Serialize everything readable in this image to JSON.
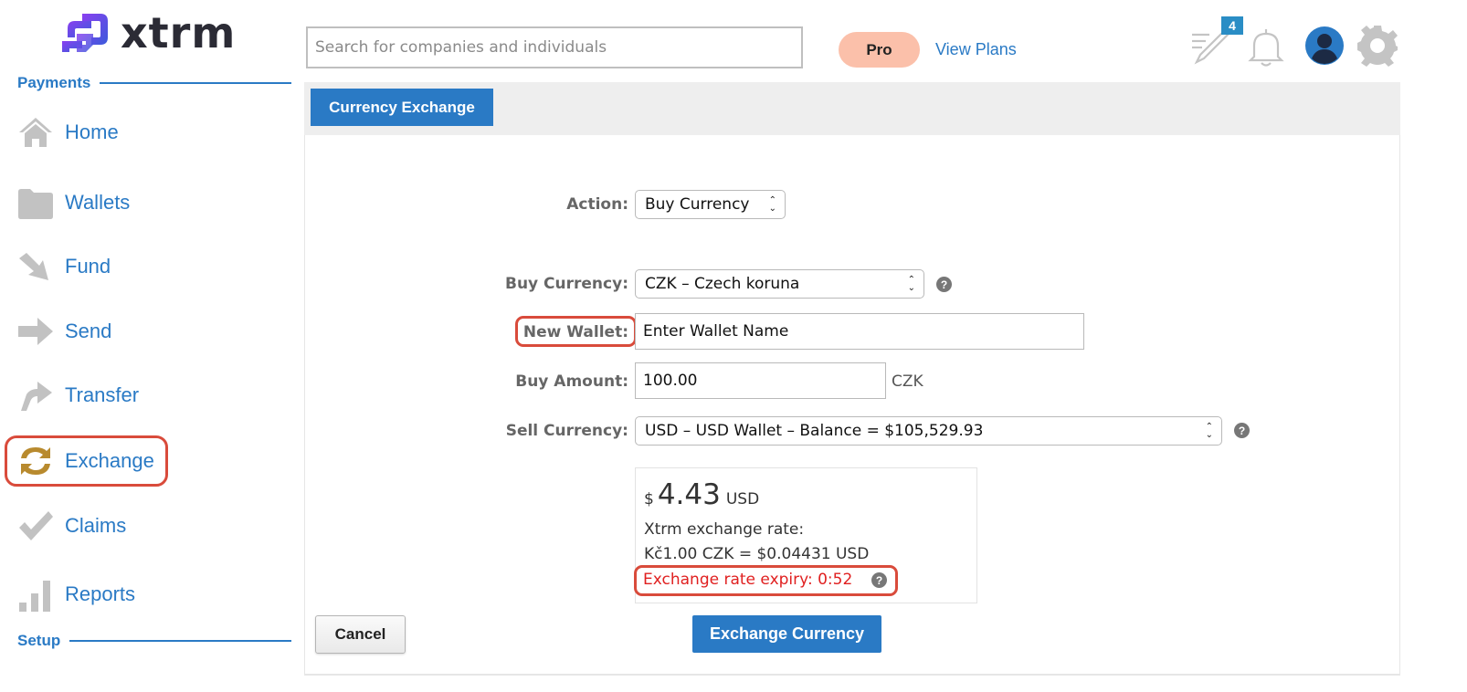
{
  "brand": {
    "name": "xtrm",
    "colors": {
      "primary": "#2a7ac5",
      "logo_gradient": [
        "#7b3fe4",
        "#3b5bdb"
      ],
      "highlight": "#d94b3b",
      "error_text": "#e02020",
      "pro_badge": "#fbc0aa"
    }
  },
  "sidebar": {
    "sections": [
      {
        "label": "Payments"
      },
      {
        "label": "Setup"
      }
    ],
    "items": [
      {
        "label": "Home",
        "icon": "home-icon"
      },
      {
        "label": "Wallets",
        "icon": "folder-icon"
      },
      {
        "label": "Fund",
        "icon": "fund-arrow-icon"
      },
      {
        "label": "Send",
        "icon": "send-arrow-icon"
      },
      {
        "label": "Transfer",
        "icon": "transfer-arrow-icon"
      },
      {
        "label": "Exchange",
        "icon": "exchange-icon",
        "active": true
      },
      {
        "label": "Claims",
        "icon": "checkmark-icon"
      },
      {
        "label": "Reports",
        "icon": "bar-chart-icon"
      }
    ]
  },
  "topbar": {
    "search": {
      "placeholder": "Search for companies and individuals",
      "value": ""
    },
    "plan_badge": "Pro",
    "view_plans": "View Plans",
    "notification_count": "4"
  },
  "main": {
    "tab": "Currency Exchange",
    "form": {
      "action": {
        "label": "Action:",
        "value": "Buy Currency"
      },
      "buy_currency": {
        "label": "Buy Currency:",
        "value": "CZK – Czech koruna"
      },
      "new_wallet": {
        "label": "New Wallet:",
        "value": "Enter Wallet Name"
      },
      "buy_amount": {
        "label": "Buy Amount:",
        "value": "100.00",
        "unit": "CZK"
      },
      "sell_currency": {
        "label": "Sell Currency:",
        "value": "USD – USD Wallet – Balance = $105,529.93"
      }
    },
    "quote": {
      "symbol": "$",
      "amount": "4.43",
      "unit": "USD",
      "rate_label": "Xtrm exchange rate:",
      "rate_value": "Kč1.00 CZK = $0.04431 USD",
      "expiry": "Exchange rate expiry: 0:52"
    },
    "buttons": {
      "cancel": "Cancel",
      "submit": "Exchange Currency"
    }
  }
}
